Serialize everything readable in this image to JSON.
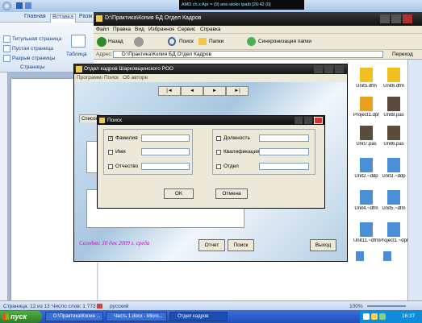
{
  "word": {
    "tabs": [
      "Главная",
      "Вставка",
      "Разм"
    ],
    "ribbon_items": [
      "Титульная страница",
      "Пустая страница",
      "Разрыв страницы"
    ],
    "ribbon_table_label": "Таблица",
    "ribbon_group_label": "Страницы",
    "status": {
      "page": "Страница: 12 из 13",
      "words": "Число слов: 1 773",
      "language": "русский",
      "zoom": "100%"
    }
  },
  "media_bar": {
    "text": "AMD ch.x  Apr = (9)  ane-stokn tpaib  [26:42 (0] "
  },
  "explorer": {
    "title": "D:\\Практика\\Копия БД Отдел Кадров",
    "menu": [
      "Файл",
      "Правка",
      "Вид",
      "Избранное",
      "Сервис",
      "Справка"
    ],
    "toolbar": {
      "back": "Назад",
      "search": "Поиск",
      "folders": "Папки",
      "sync": "Синхронизация папки"
    },
    "address_label": "Адрес:",
    "address_value": "D:\\Практика\\Копия БД Отдел Кадров",
    "go_label": "Переход",
    "files": [
      "Unit5.dfm",
      "Unit6.dfm",
      "Project1.dpr",
      "Unit8.pas",
      "Unit7.pas",
      "Unit6.pas",
      "Unit2.~ddp",
      "Unit3.~ddp",
      "Unit4.~dfm",
      "Unit5.~dfm",
      "Unit11.~dfm",
      "Project1.~dpr"
    ]
  },
  "app": {
    "title": "Отдел кадров  Шарковщинского РОО",
    "menu": [
      "Программа",
      "Поиск",
      "Об авторе"
    ],
    "nav": [
      "|◄",
      "◄",
      "►",
      "►|"
    ],
    "tab_label": "Список",
    "date_text": "Сегодня: 30 дек 2009 г. среда",
    "buttons": {
      "report": "Отчет",
      "search": "Поиск",
      "exit": "Выход"
    }
  },
  "search_dialog": {
    "title": "Поиск",
    "left_fields": [
      {
        "label": "Фамилия",
        "checked": true,
        "value": ""
      },
      {
        "label": "Имя",
        "checked": false,
        "value": ""
      },
      {
        "label": "Отчество",
        "checked": false,
        "value": ""
      }
    ],
    "right_fields": [
      {
        "label": "Должность",
        "checked": false,
        "value": ""
      },
      {
        "label": "Квалификация",
        "checked": false,
        "value": ""
      },
      {
        "label": "Отдел",
        "checked": false,
        "value": ""
      }
    ],
    "ok_label": "OK",
    "cancel_label": "Отмена"
  },
  "taskbar": {
    "start_label": "пуск",
    "tasks": [
      "D:\\Практика\\Копия ...",
      "Часть 1.docx - Micro...",
      "Отдел кадров"
    ],
    "clock": "16:37"
  },
  "colors": {
    "accent": "#c40000",
    "date_text": "#d400c8",
    "taskbar": "#2456c4"
  }
}
